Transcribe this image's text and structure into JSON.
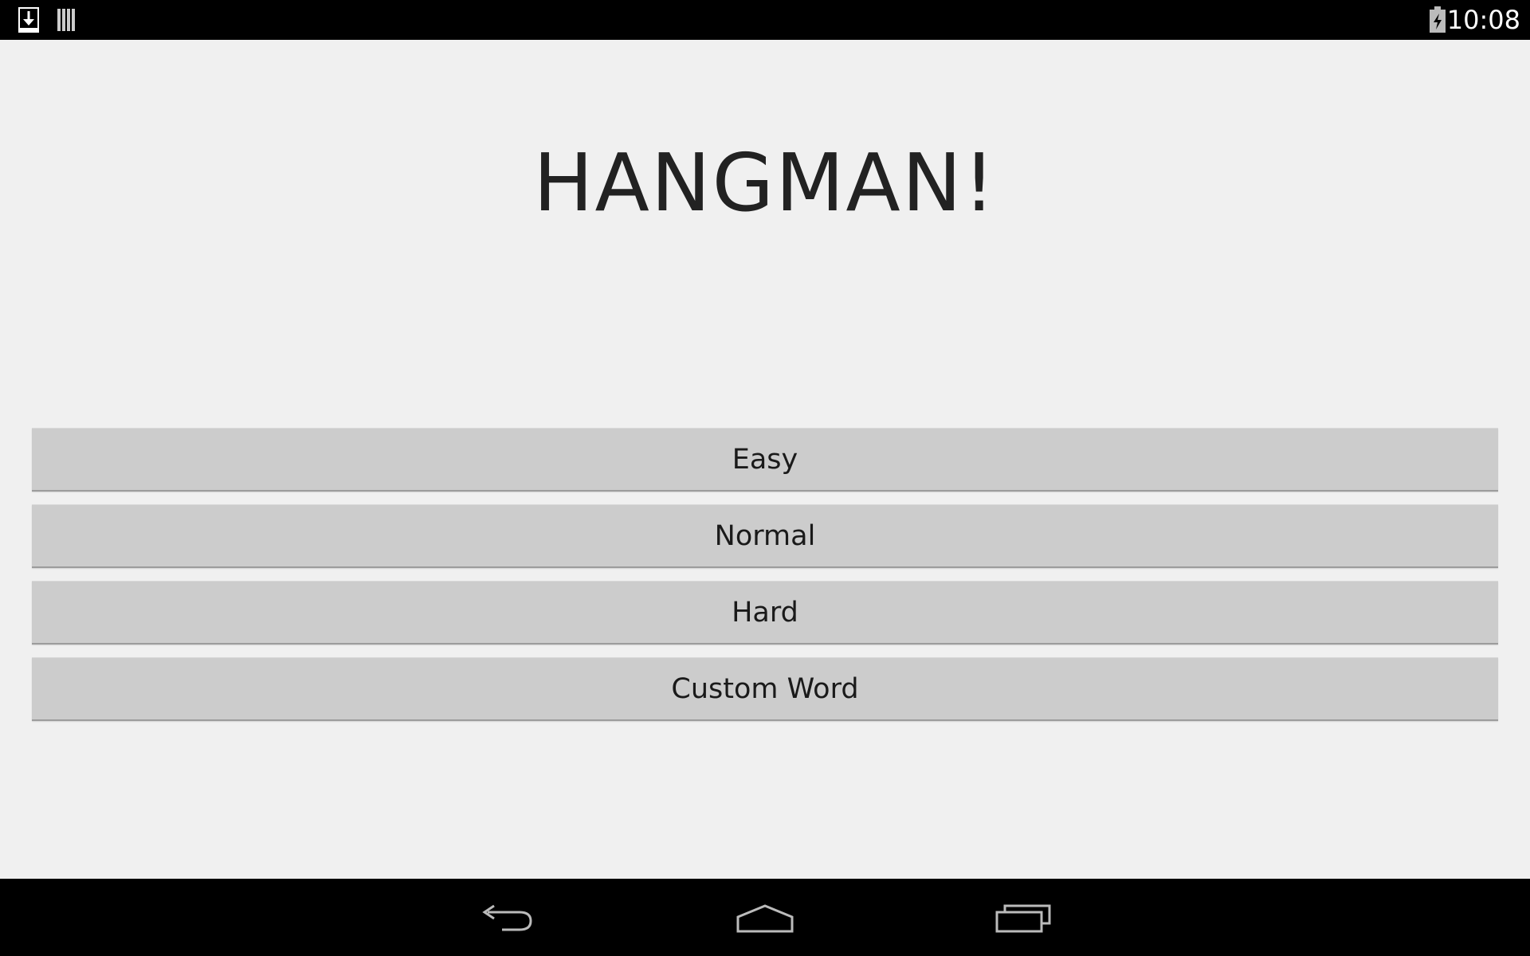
{
  "status_bar": {
    "time": "10:08",
    "icons": [
      "download-icon",
      "barcode-icon",
      "battery-charging-icon"
    ]
  },
  "app": {
    "title": "HANGMAN!"
  },
  "menu": {
    "buttons": [
      {
        "label": "Easy"
      },
      {
        "label": "Normal"
      },
      {
        "label": "Hard"
      },
      {
        "label": "Custom Word"
      }
    ]
  },
  "nav_bar": {
    "icons": [
      "back-icon",
      "home-icon",
      "recent-apps-icon"
    ]
  },
  "colors": {
    "background": "#f0f0f0",
    "button": "#cccccc",
    "bars": "#000000",
    "text": "#222222"
  }
}
